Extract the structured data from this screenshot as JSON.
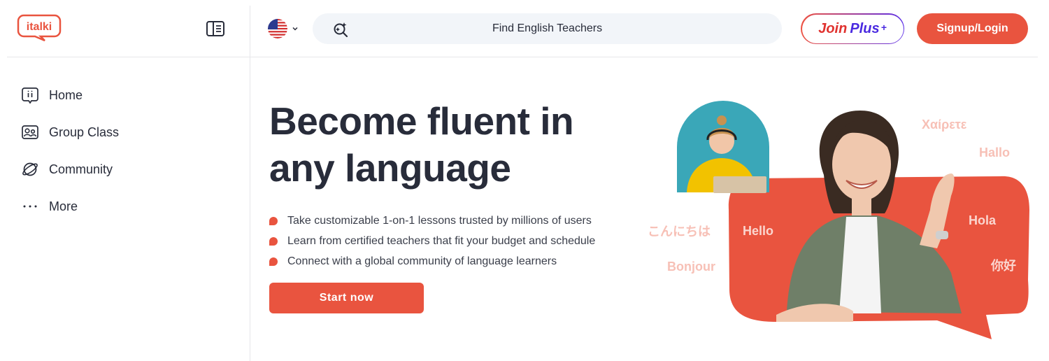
{
  "brand": {
    "logo_text": "italki",
    "accent": "#e9543f"
  },
  "header": {
    "language_flag": "us-flag-icon",
    "search_text": "Find English Teachers",
    "join_plus": {
      "join": "Join",
      "plus": "Plus",
      "mark": "+"
    },
    "signup_label": "Signup/Login"
  },
  "sidebar": {
    "items": [
      {
        "label": "Home",
        "icon": "home-icon"
      },
      {
        "label": "Group Class",
        "icon": "group-class-icon"
      },
      {
        "label": "Community",
        "icon": "community-icon"
      },
      {
        "label": "More",
        "icon": "more-icon"
      }
    ]
  },
  "hero": {
    "title_line1": "Become fluent in",
    "title_line2": "any language",
    "bullets": [
      "Take customizable 1-on-1 lessons trusted by millions of users",
      "Learn from certified teachers that fit your budget and schedule",
      "Connect with a global community of language learners"
    ],
    "cta_label": "Start now"
  },
  "illustration": {
    "greetings": {
      "greek": "Χαίρετε",
      "german": "Hallo",
      "japanese": "こんにちは",
      "english": "Hello",
      "spanish": "Hola",
      "french": "Bonjour",
      "chinese": "你好"
    }
  }
}
